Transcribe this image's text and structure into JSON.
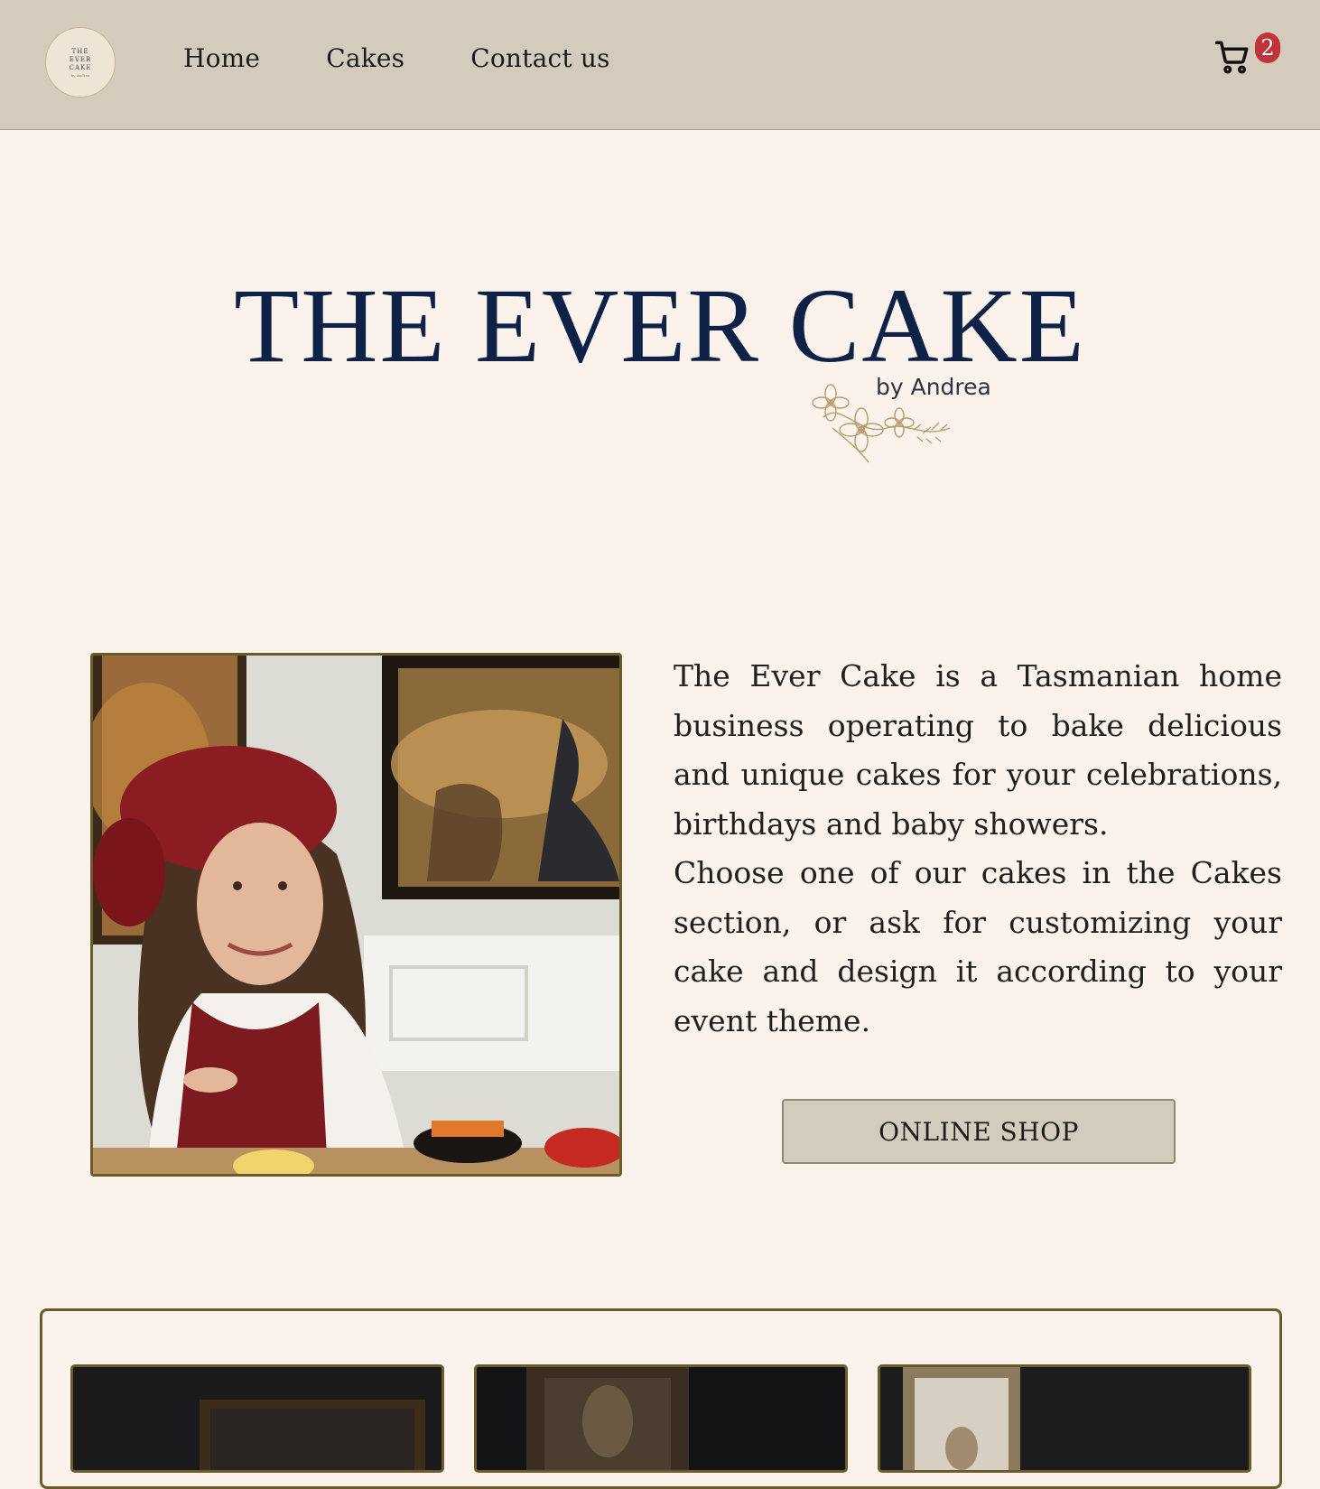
{
  "header": {
    "logo": {
      "text": "THE EVER CAKE",
      "sub": "by Andrea"
    },
    "nav": [
      {
        "label": "Home"
      },
      {
        "label": "Cakes"
      },
      {
        "label": "Contact us"
      }
    ],
    "cart": {
      "count": "2",
      "icon": "cart-icon"
    }
  },
  "hero": {
    "title": "THE EVER CAKE",
    "subtitle": "by Andrea",
    "ornament": "floral-ornament"
  },
  "about": {
    "photo_icon": "portrait-photo",
    "paragraphs": [
      "The Ever Cake is a Tasmanian home business operating to bake delicious and unique cakes for your celebrations, birthdays and baby showers.",
      "Choose one of our cakes in the Cakes section, or ask for customizing your cake and design it according to your event theme."
    ],
    "button_label": "ONLINE SHOP"
  },
  "gallery": {
    "cards": [
      {
        "icon": "cake-photo"
      },
      {
        "icon": "cake-photo"
      },
      {
        "icon": "cake-photo"
      }
    ]
  },
  "colors": {
    "header_bg": "#d5cbbd",
    "page_bg": "#fbf3eb",
    "title_navy": "#0e2146",
    "frame_gold": "#6b5a2a",
    "badge_red": "#c0333a"
  }
}
